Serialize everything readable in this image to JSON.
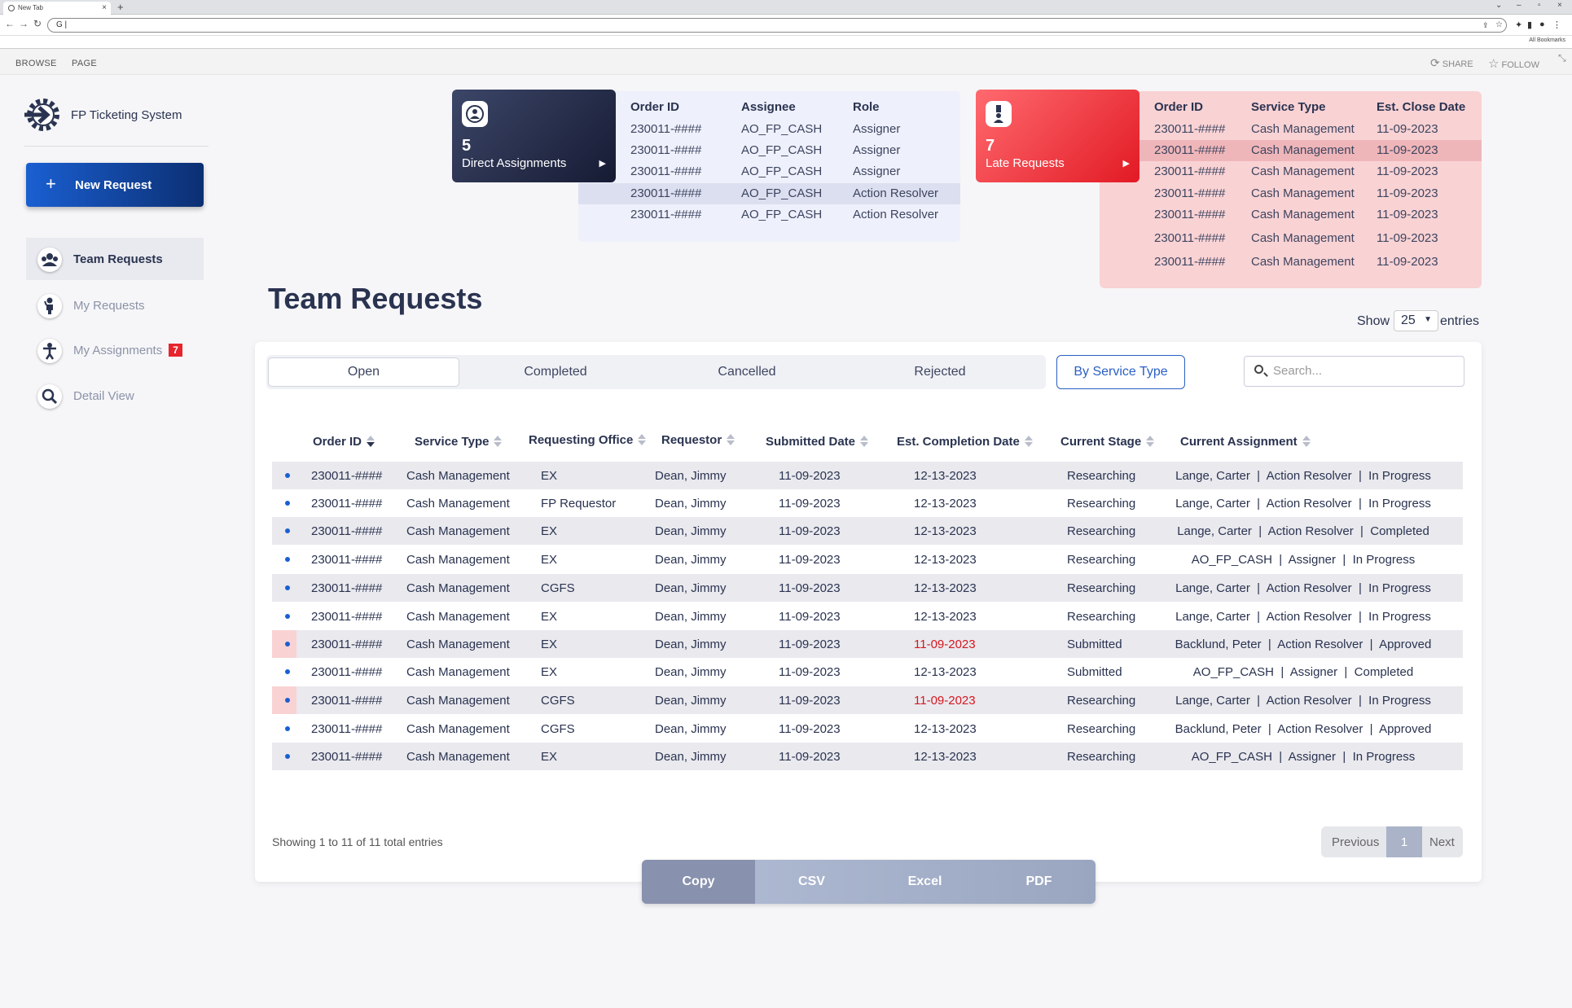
{
  "browser": {
    "tab_title": "New Tab",
    "omnibox_text": "G |",
    "bookmarks_label": "All Bookmarks"
  },
  "ribbon": {
    "browse": "BROWSE",
    "page": "PAGE",
    "share": "SHARE",
    "follow": "FOLLOW"
  },
  "app": {
    "title": "FP Ticketing System",
    "new_request": "New Request"
  },
  "nav": [
    {
      "label": "Team Requests",
      "icon": "team-icon",
      "badge": ""
    },
    {
      "label": "My Requests",
      "icon": "person-icon",
      "badge": ""
    },
    {
      "label": "My Assignments",
      "icon": "assignment-icon",
      "badge": "7"
    },
    {
      "label": "Detail View",
      "icon": "magnifier-icon",
      "badge": ""
    }
  ],
  "direct": {
    "count": "5",
    "label": "Direct Assignments",
    "headers": [
      "Order ID",
      "Assignee",
      "Role"
    ],
    "rows": [
      [
        "230011-####",
        "AO_FP_CASH",
        "Assigner"
      ],
      [
        "230011-####",
        "AO_FP_CASH",
        "Assigner"
      ],
      [
        "230011-####",
        "AO_FP_CASH",
        "Assigner"
      ],
      [
        "230011-####",
        "AO_FP_CASH",
        "Action Resolver"
      ],
      [
        "230011-####",
        "AO_FP_CASH",
        "Action Resolver"
      ]
    ]
  },
  "late": {
    "count": "7",
    "label": "Late Requests",
    "headers": [
      "Order ID",
      "Service Type",
      "Est. Close Date"
    ],
    "rows": [
      [
        "230011-####",
        "Cash Management",
        "11-09-2023"
      ],
      [
        "230011-####",
        "Cash Management",
        "11-09-2023"
      ],
      [
        "230011-####",
        "Cash Management",
        "11-09-2023"
      ],
      [
        "230011-####",
        "Cash Management",
        "11-09-2023"
      ],
      [
        "230011-####",
        "Cash Management",
        "11-09-2023"
      ],
      [
        "230011-####",
        "Cash Management",
        "11-09-2023"
      ],
      [
        "230011-####",
        "Cash Management",
        "11-09-2023"
      ]
    ]
  },
  "main": {
    "title": "Team Requests",
    "show": "Show",
    "entries_value": "25",
    "entries": "entries",
    "tabs": [
      "Open",
      "Completed",
      "Cancelled",
      "Rejected"
    ],
    "by_service": "By Service Type",
    "search_placeholder": "Search...",
    "columns": [
      "Order ID",
      "Service Type",
      "Requesting Office",
      "Requestor",
      "Submitted Date",
      "Est. Completion Date",
      "Current Stage",
      "Current Assignment"
    ],
    "rows": [
      {
        "late": false,
        "cells": [
          "230011-####",
          "Cash Management",
          "EX",
          "Dean, Jimmy",
          "11-09-2023",
          "12-13-2023",
          "Researching",
          "Lange, Carter  |  Action Resolver  |  In Progress"
        ]
      },
      {
        "late": false,
        "cells": [
          "230011-####",
          "Cash Management",
          "FP Requestor",
          "Dean, Jimmy",
          "11-09-2023",
          "12-13-2023",
          "Researching",
          "Lange, Carter  |  Action Resolver  |  In Progress"
        ]
      },
      {
        "late": false,
        "cells": [
          "230011-####",
          "Cash Management",
          "EX",
          "Dean, Jimmy",
          "11-09-2023",
          "12-13-2023",
          "Researching",
          "Lange, Carter  |  Action Resolver  |  Completed"
        ]
      },
      {
        "late": false,
        "cells": [
          "230011-####",
          "Cash Management",
          "EX",
          "Dean, Jimmy",
          "11-09-2023",
          "12-13-2023",
          "Researching",
          "AO_FP_CASH  |  Assigner  |  In Progress"
        ]
      },
      {
        "late": false,
        "cells": [
          "230011-####",
          "Cash Management",
          "CGFS",
          "Dean, Jimmy",
          "11-09-2023",
          "12-13-2023",
          "Researching",
          "Lange, Carter  |  Action Resolver  |  In Progress"
        ]
      },
      {
        "late": false,
        "cells": [
          "230011-####",
          "Cash Management",
          "EX",
          "Dean, Jimmy",
          "11-09-2023",
          "12-13-2023",
          "Researching",
          "Lange, Carter  |  Action Resolver  |  In Progress"
        ]
      },
      {
        "late": true,
        "cells": [
          "230011-####",
          "Cash Management",
          "EX",
          "Dean, Jimmy",
          "11-09-2023",
          "11-09-2023",
          "Submitted",
          "Backlund, Peter  |  Action Resolver  |  Approved"
        ]
      },
      {
        "late": false,
        "cells": [
          "230011-####",
          "Cash Management",
          "EX",
          "Dean, Jimmy",
          "11-09-2023",
          "12-13-2023",
          "Submitted",
          "AO_FP_CASH  |  Assigner  |  Completed"
        ]
      },
      {
        "late": true,
        "cells": [
          "230011-####",
          "Cash Management",
          "CGFS",
          "Dean, Jimmy",
          "11-09-2023",
          "11-09-2023",
          "Researching",
          "Lange, Carter  |  Action Resolver  |  In Progress"
        ]
      },
      {
        "late": false,
        "cells": [
          "230011-####",
          "Cash Management",
          "CGFS",
          "Dean, Jimmy",
          "11-09-2023",
          "12-13-2023",
          "Researching",
          "Backlund, Peter  |  Action Resolver  |  Approved"
        ]
      },
      {
        "late": false,
        "cells": [
          "230011-####",
          "Cash Management",
          "EX",
          "Dean, Jimmy",
          "11-09-2023",
          "12-13-2023",
          "Researching",
          "AO_FP_CASH  |  Assigner  |  In Progress"
        ]
      }
    ],
    "showing": "Showing 1 to 11 of 11 total entries",
    "pager": {
      "prev": "Previous",
      "page": "1",
      "next": "Next"
    },
    "export": [
      "Copy",
      "CSV",
      "Excel",
      "PDF"
    ]
  },
  "colors": {
    "primary": "#1a5fd2",
    "late": "#e21a24",
    "navy": "#2a3350"
  }
}
